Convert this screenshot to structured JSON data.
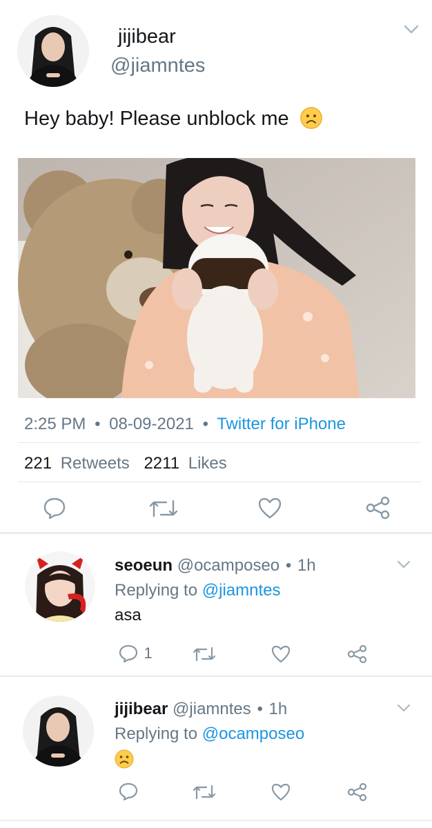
{
  "main_tweet": {
    "display_name": "jijibear",
    "handle": "@jiamntes",
    "text": "Hey baby! Please unblock me",
    "time": "2:25 PM",
    "date": "08-09-2021",
    "source": "Twitter for iPhone",
    "retweets_count": "221",
    "retweets_label": "Retweets",
    "likes_count": "2211",
    "likes_label": "Likes"
  },
  "replies": [
    {
      "display_name": "seoeun",
      "handle": "@ocamposeo",
      "time": "1h",
      "replying_prefix": "Replying to",
      "replying_to": "@jiamntes",
      "text": "asa",
      "reply_count": "1"
    },
    {
      "display_name": "jijibear",
      "handle": "@jiamntes",
      "time": "1h",
      "replying_prefix": "Replying to",
      "replying_to": "@ocamposeo",
      "text": ""
    }
  ],
  "icons": {
    "reply": "reply-icon",
    "retweet": "retweet-icon",
    "like": "heart-icon",
    "share": "share-icon",
    "menu": "chevron-down-icon",
    "emoji": "frowning-face-emoji"
  },
  "colors": {
    "link": "#1b95e0",
    "secondary_text": "#657786",
    "divider": "#e1e8ed",
    "emoji": "#ffcc4d"
  }
}
